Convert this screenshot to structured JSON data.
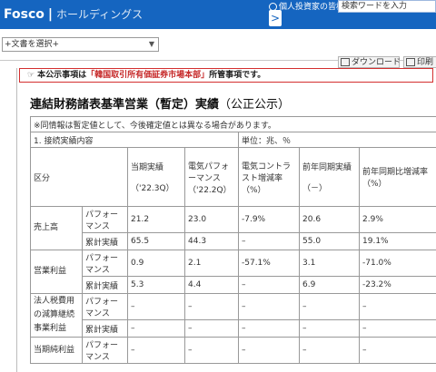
{
  "header": {
    "brand": "Fosco",
    "sub": "ホールディングス",
    "links": [
      "個人投資家の皆様",
      "お問い合わせ"
    ],
    "nav_arrow": ">",
    "search_value": "検索ワードを入力"
  },
  "toolbar": {
    "doc_select": "+文書を選択+",
    "download_label": "ダウンロード",
    "print_label": "印刷"
  },
  "notice": {
    "prefix": "本公示事項は",
    "highlight": "「韓国取引所有価証券市場本部」",
    "suffix": "所管事項です。"
  },
  "report": {
    "title_bold": "連結財務諸表基準営業（暫定）実績",
    "title_normal": "（公正公示）",
    "note": "※同情報は暫定値として、今後確定値とは異なる場合があります。",
    "section": "1. 接続実績内容",
    "unit": "単位：兆、％",
    "headers": {
      "category": "区分",
      "current": "当期実績",
      "current_period": "（'22.3Q）",
      "prev": "電気パフォーマンス",
      "prev_period": "（'22.2Q）",
      "prev_change": "電気コントラスト増減率",
      "prev_change_unit": "（%）",
      "yoy": "前年同期実績",
      "yoy_period": "（－）",
      "yoy_change": "前年同期比増減率（%）"
    },
    "rows": [
      {
        "group": "売上高",
        "sub": "パフォーマンス",
        "cur": "21.2",
        "prev": "23.0",
        "prev_chg": "-7.9%",
        "yoy": "20.6",
        "yoy_chg": "2.9%"
      },
      {
        "group": "",
        "sub": "累計実績",
        "cur": "65.5",
        "prev": "44.3",
        "prev_chg": "–",
        "yoy": "55.0",
        "yoy_chg": "19.1%"
      },
      {
        "group": "営業利益",
        "sub": "パフォーマンス",
        "cur": "0.9",
        "prev": "2.1",
        "prev_chg": "-57.1%",
        "yoy": "3.1",
        "yoy_chg": "-71.0%"
      },
      {
        "group": "",
        "sub": "累計実績",
        "cur": "5.3",
        "prev": "4.4",
        "prev_chg": "–",
        "yoy": "6.9",
        "yoy_chg": "-23.2%"
      },
      {
        "group": "法人税費用の減算継続事業利益",
        "sub": "パフォーマンス",
        "cur": "–",
        "prev": "–",
        "prev_chg": "–",
        "yoy": "–",
        "yoy_chg": "–"
      },
      {
        "group": "",
        "sub": "累計実績",
        "cur": "–",
        "prev": "–",
        "prev_chg": "–",
        "yoy": "–",
        "yoy_chg": "–"
      },
      {
        "group": "当期純利益",
        "sub": "パフォーマンス",
        "cur": "–",
        "prev": "–",
        "prev_chg": "–",
        "yoy": "–",
        "yoy_chg": "–"
      }
    ]
  }
}
